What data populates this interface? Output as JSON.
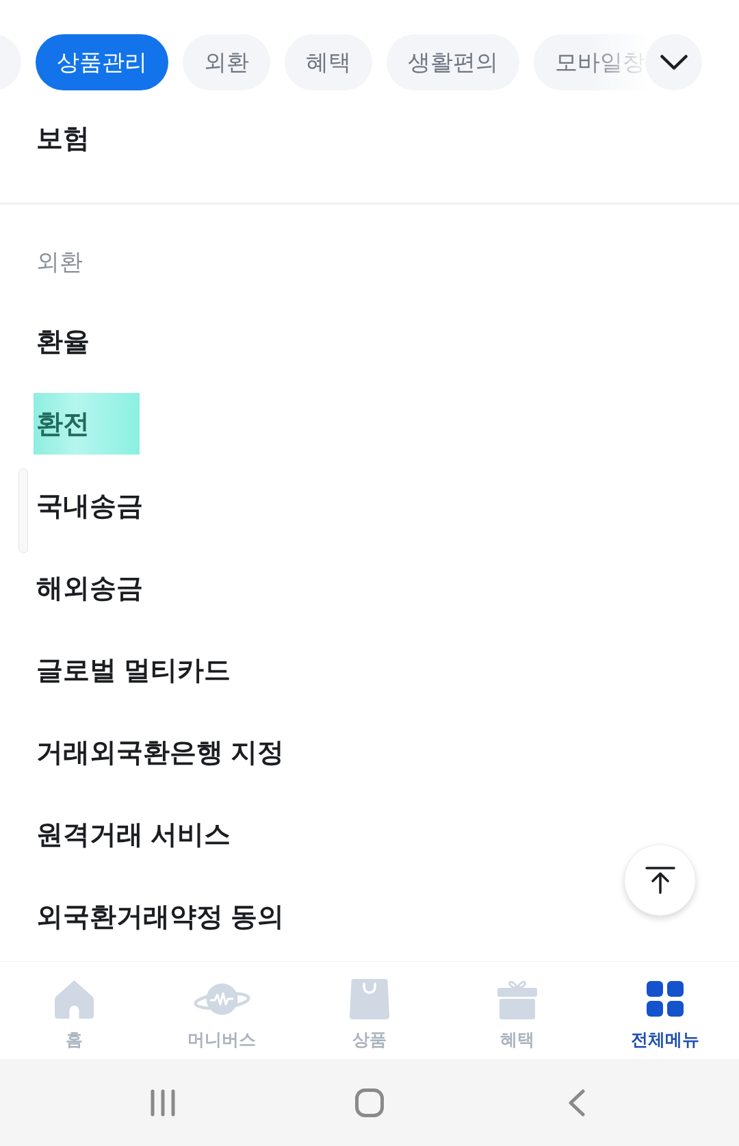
{
  "category_tabs": [
    {
      "selected": false
    },
    {
      "label": "상품관리",
      "selected": true
    },
    {
      "label": "외환",
      "selected": false
    },
    {
      "label": "혜택",
      "selected": false
    },
    {
      "label": "생활편의",
      "selected": false
    },
    {
      "label": "모바일창",
      "selected": false
    }
  ],
  "sections": [
    {
      "items": [
        {
          "label": "보험",
          "highlighted": false
        }
      ]
    },
    {
      "title": "외환",
      "items": [
        {
          "label": "환율",
          "highlighted": false
        },
        {
          "label": "환전",
          "highlighted": true
        },
        {
          "label": "국내송금",
          "highlighted": false
        },
        {
          "label": "해외송금",
          "highlighted": false
        },
        {
          "label": "글로벌 멀티카드",
          "highlighted": false
        },
        {
          "label": "거래외국환은행 지정",
          "highlighted": false
        },
        {
          "label": "원격거래 서비스",
          "highlighted": false
        },
        {
          "label": "외국환거래약정 동의",
          "highlighted": false
        }
      ]
    }
  ],
  "bottom_nav": [
    {
      "kind": "home",
      "label": "홈",
      "selected": false
    },
    {
      "kind": "planet",
      "label": "머니버스",
      "selected": false
    },
    {
      "kind": "bag",
      "label": "상품",
      "selected": false
    },
    {
      "kind": "gift",
      "label": "혜택",
      "selected": false
    },
    {
      "kind": "grid",
      "label": "전체메뉴",
      "selected": true
    }
  ]
}
